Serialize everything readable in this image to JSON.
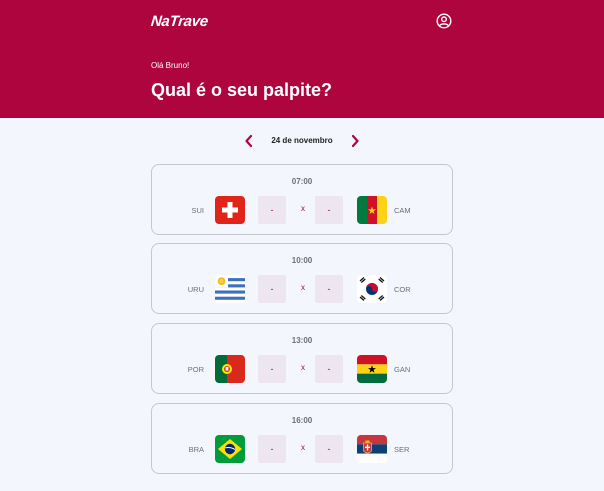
{
  "colors": {
    "brand": "#af053f",
    "background": "#f4f6fe",
    "card_border": "#c4c7d2",
    "score_bg": "#ede5ef"
  },
  "header": {
    "logo_text": "NaTrave",
    "profile_icon": "user-circle-icon",
    "greeting": "Olá Bruno!",
    "headline": "Qual é o seu palpite?"
  },
  "date_nav": {
    "prev_icon": "chevron-left-icon",
    "next_icon": "chevron-right-icon",
    "date": "24 de novembro"
  },
  "games": [
    {
      "time": "07:00",
      "home": "SUI",
      "away": "CAM",
      "home_flag": "switzerland-flag-icon",
      "away_flag": "cameroon-flag-icon",
      "home_score_placeholder": "-",
      "away_score_placeholder": "-",
      "vs": "x"
    },
    {
      "time": "10:00",
      "home": "URU",
      "away": "COR",
      "home_flag": "uruguay-flag-icon",
      "away_flag": "south-korea-flag-icon",
      "home_score_placeholder": "-",
      "away_score_placeholder": "-",
      "vs": "x"
    },
    {
      "time": "13:00",
      "home": "POR",
      "away": "GAN",
      "home_flag": "portugal-flag-icon",
      "away_flag": "ghana-flag-icon",
      "home_score_placeholder": "-",
      "away_score_placeholder": "-",
      "vs": "x"
    },
    {
      "time": "16:00",
      "home": "BRA",
      "away": "SER",
      "home_flag": "brazil-flag-icon",
      "away_flag": "serbia-flag-icon",
      "home_score_placeholder": "-",
      "away_score_placeholder": "-",
      "vs": "x"
    }
  ]
}
